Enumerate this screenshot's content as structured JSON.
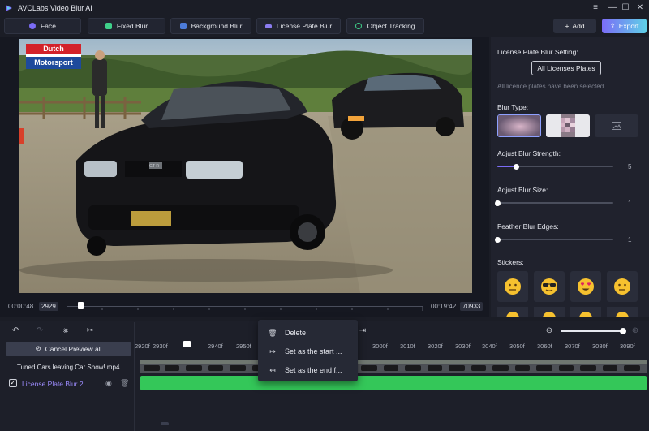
{
  "app": {
    "title": "AVCLabs Video Blur AI"
  },
  "window_controls": {
    "menu": "≡",
    "minimize": "—",
    "maximize": "☐",
    "close": "✕"
  },
  "tabs": [
    {
      "label": "Face"
    },
    {
      "label": "Fixed Blur"
    },
    {
      "label": "Background Blur"
    },
    {
      "label": "License Plate Blur"
    },
    {
      "label": "Object Tracking"
    }
  ],
  "toolbar": {
    "add_label": "Add",
    "export_label": "Export"
  },
  "video": {
    "overlay_top": "Dutch",
    "overlay_bottom": "Motorsport",
    "plate_text": "GT-R"
  },
  "settings": {
    "header": "License Plate Blur Setting:",
    "all_plates_button": "All Licenses Plates",
    "selected_note": "All licence plates have been selected",
    "blur_type_label": "Blur Type:",
    "blur_strength": {
      "label": "Adjust Blur Strength:",
      "value": 5,
      "max": 25
    },
    "blur_size": {
      "label": "Adjust Blur Size:",
      "value": 1,
      "max": 25
    },
    "feather": {
      "label": "Feather Blur Edges:",
      "value": 1,
      "max": 25
    },
    "stickers_label": "Stickers:",
    "stickers": [
      "neutral",
      "cool",
      "heart-eyes",
      "neutral"
    ]
  },
  "transport": {
    "current_time": "00:00:48",
    "current_frame": "2929",
    "end_time": "00:19:42",
    "end_frame": "70933"
  },
  "timeline": {
    "cancel_preview": "Cancel Preview all",
    "clip_name": "Tuned Cars leaving Car Show!.mp4",
    "blur_track_name": "License Plate Blur 2",
    "ruler": [
      "2920f",
      "2930f",
      "2940f",
      "2950f",
      "3000f",
      "3010f",
      "3020f",
      "3030f",
      "3040f",
      "3050f",
      "3060f",
      "3070f",
      "3080f",
      "3090f"
    ]
  },
  "context_menu": {
    "items": [
      {
        "label": "Delete"
      },
      {
        "label": "Set as the start ..."
      },
      {
        "label": "Set as the end f..."
      }
    ]
  },
  "colors": {
    "accent_purple": "#7b6cf6",
    "accent_green": "#34c759"
  }
}
